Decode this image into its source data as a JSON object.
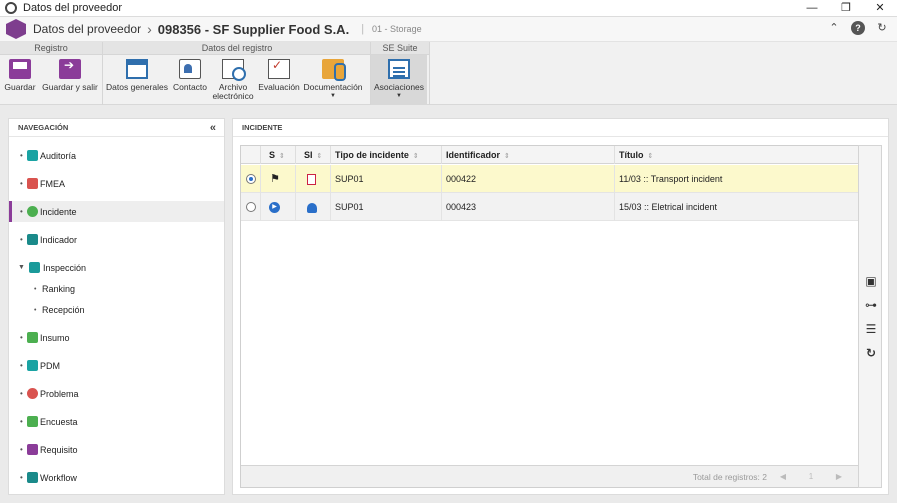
{
  "window": {
    "title": "Datos del proveedor",
    "controls": [
      "—",
      "❐",
      "✕"
    ]
  },
  "header": {
    "title": "Datos del proveedor",
    "separator": "›",
    "record": "098356 - SF Supplier Food S.A.",
    "pipe": "|",
    "subtitle": "01 - Storage"
  },
  "ribbon": {
    "groups": [
      {
        "label": "Registro",
        "buttons": [
          "Guardar",
          "Guardar y salir"
        ]
      },
      {
        "label": "Datos del registro",
        "buttons": [
          "Datos generales",
          "Contacto",
          "Archivo electrónico",
          "Evaluación",
          "Documentación"
        ]
      },
      {
        "label": "SE Suite",
        "buttons": [
          "Asociaciones"
        ]
      }
    ]
  },
  "navigation": {
    "title": "NAVEGACIÓN",
    "items": [
      {
        "label": "Auditoría",
        "color": "#1aa3a3"
      },
      {
        "label": "FMEA",
        "color": "#d9534f"
      },
      {
        "label": "Incidente",
        "color": "#4caf50",
        "selected": true
      },
      {
        "label": "Indicador",
        "color": "#1a8a8a"
      },
      {
        "label": "Inspección",
        "color": "#1a9a9a",
        "expanded": true,
        "children": [
          "Ranking",
          "Recepción"
        ]
      },
      {
        "label": "Insumo",
        "color": "#4caf50"
      },
      {
        "label": "PDM",
        "color": "#1aa3a3"
      },
      {
        "label": "Problema",
        "color": "#d9534f"
      },
      {
        "label": "Encuesta",
        "color": "#4caf50"
      },
      {
        "label": "Requisito",
        "color": "#8b3c99"
      },
      {
        "label": "Workflow",
        "color": "#1a8a8a"
      }
    ]
  },
  "incidents": {
    "title": "INCIDENTE",
    "columns": [
      "S",
      "SI",
      "Tipo de incidente",
      "Identificador",
      "Título"
    ],
    "rows": [
      {
        "type": "SUP01",
        "id": "000422",
        "title": "11/03 :: Transport incident",
        "selected": true
      },
      {
        "type": "SUP01",
        "id": "000423",
        "title": "15/03 :: Eletrical incident",
        "selected": false
      }
    ],
    "total": "Total de registros: 2",
    "pager": {
      "prev": "◀",
      "page": "1",
      "next": "▶"
    }
  }
}
